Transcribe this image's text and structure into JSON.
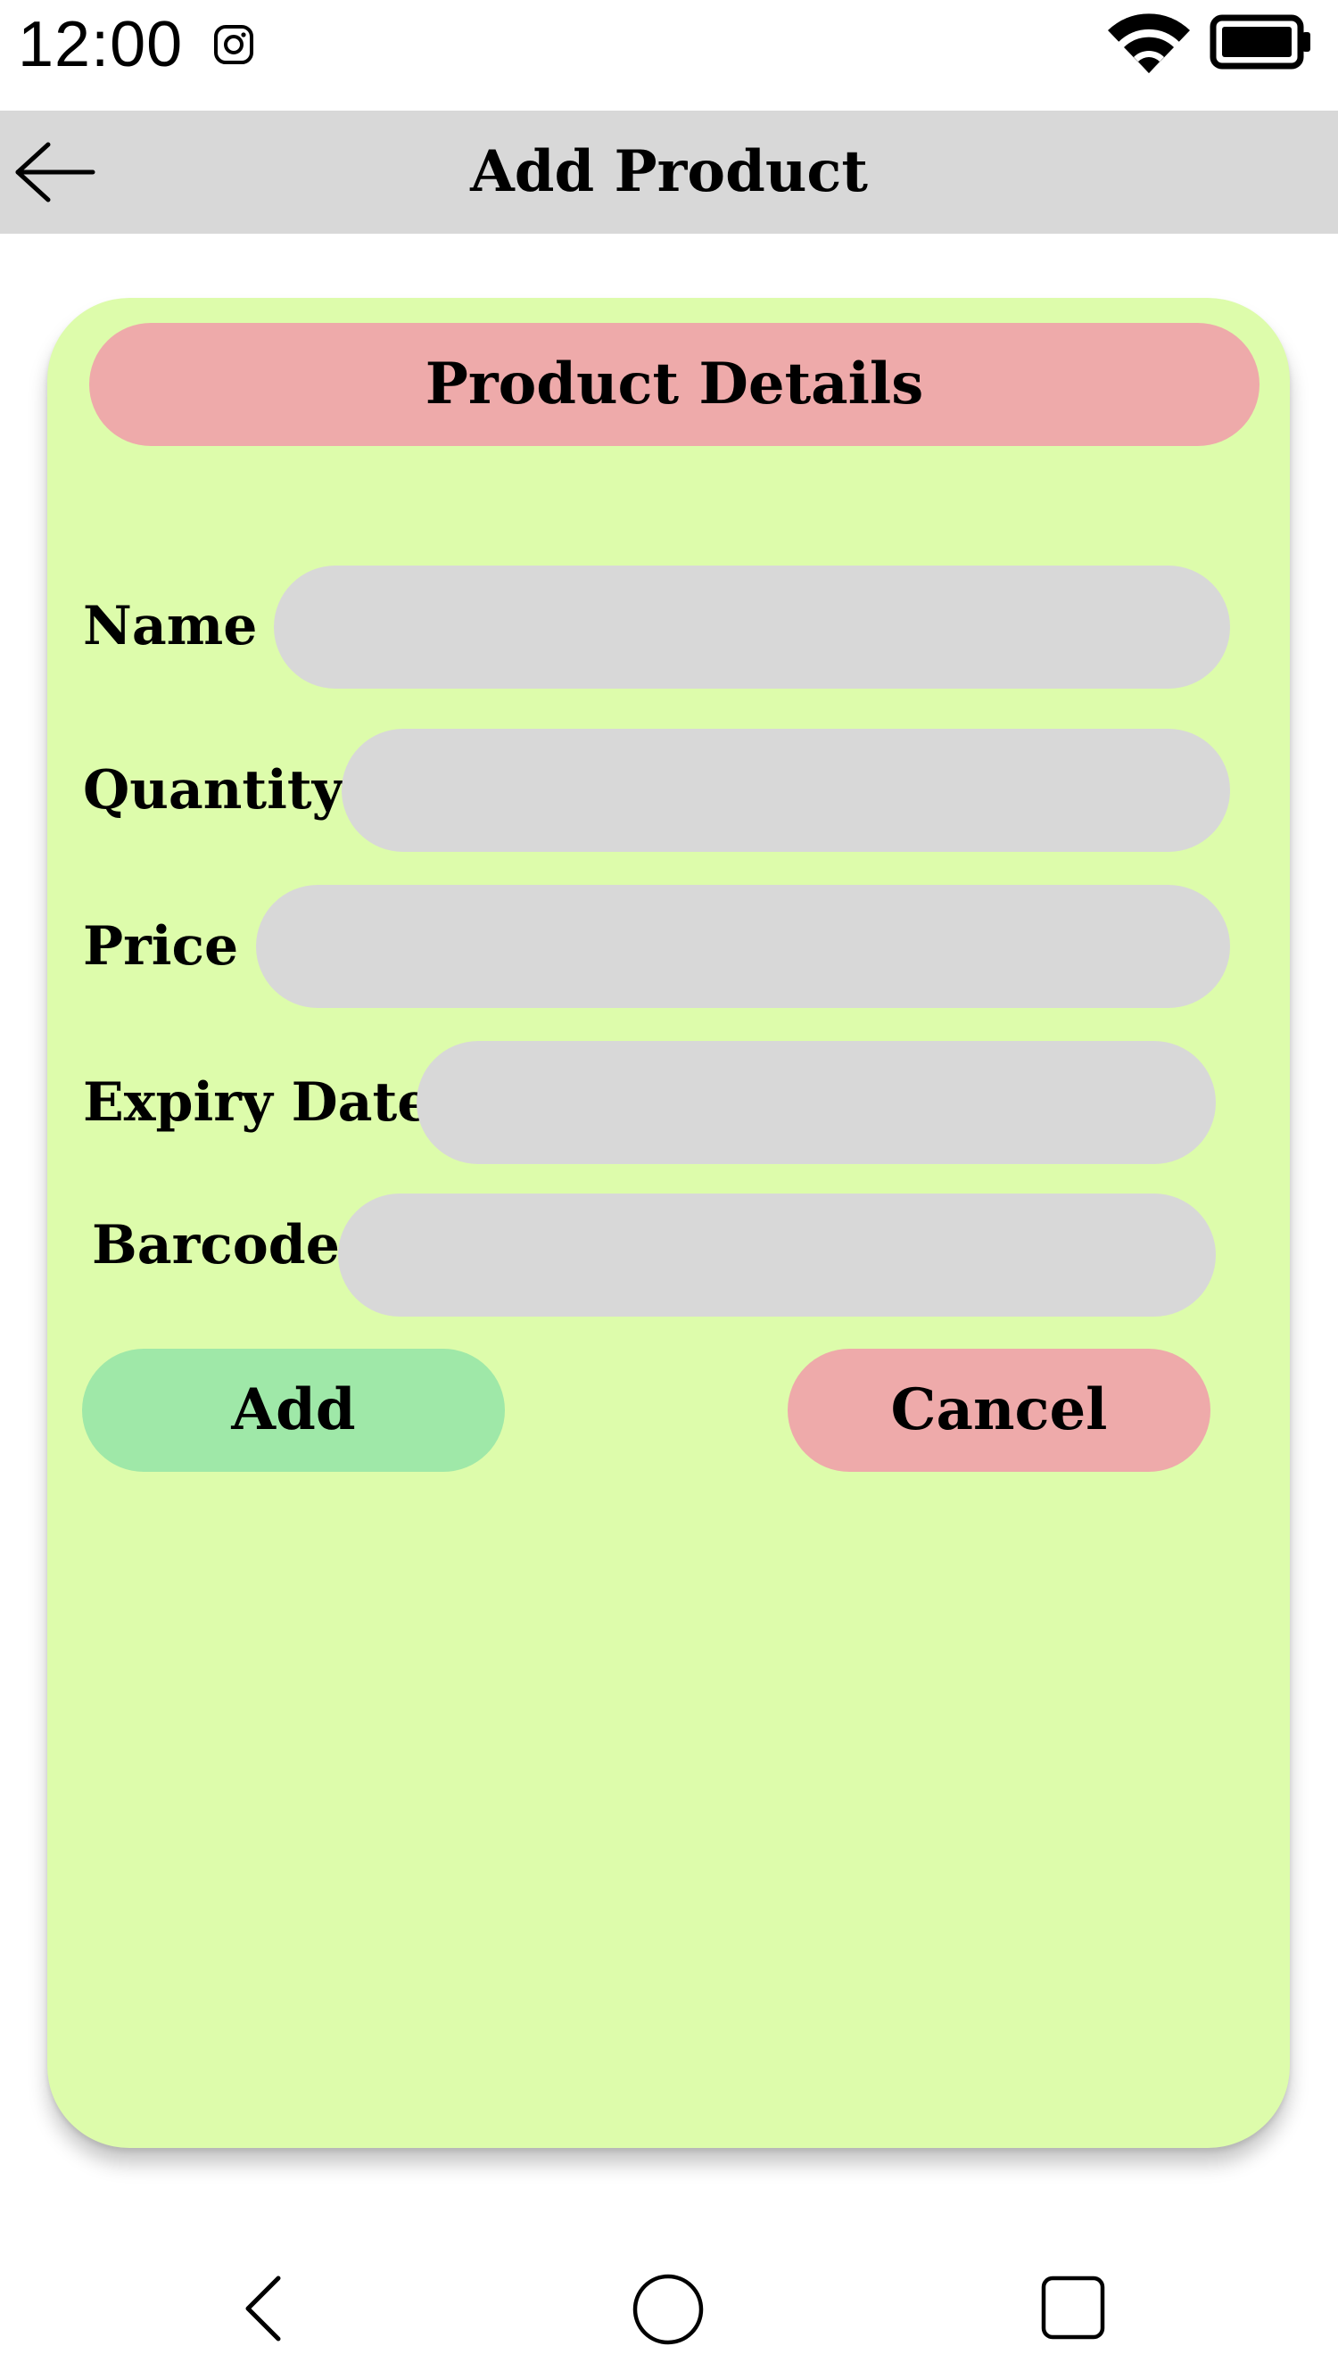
{
  "status_bar": {
    "time": "12:00",
    "icons": [
      "instagram-icon",
      "wifi-icon",
      "battery-icon"
    ]
  },
  "app_bar": {
    "title": "Add Product",
    "back_icon": "arrow-left-icon"
  },
  "form": {
    "header": "Product Details",
    "fields": [
      {
        "label": "Name",
        "value": "",
        "placeholder": ""
      },
      {
        "label": "Quantity",
        "value": "",
        "placeholder": ""
      },
      {
        "label": "Price",
        "value": "",
        "placeholder": ""
      },
      {
        "label": "Expiry Date",
        "value": "",
        "placeholder": ""
      },
      {
        "label": "Barcode",
        "value": "",
        "placeholder": ""
      }
    ],
    "add_label": "Add",
    "cancel_label": "Cancel"
  },
  "nav_bar": {
    "icons": [
      "back-triangle-icon",
      "home-circle-icon",
      "recents-square-icon"
    ]
  },
  "colors": {
    "card_background": "#ddfcab",
    "header_pill": "#eeaaaa",
    "input_fill": "#d8d8d8",
    "add_button": "#9fe8a8",
    "cancel_button": "#eeaaaa",
    "app_bar": "#d8d8d8"
  }
}
